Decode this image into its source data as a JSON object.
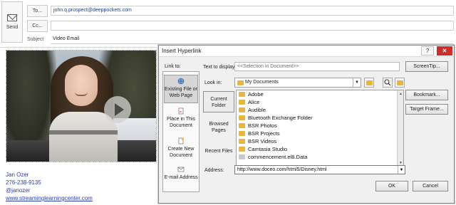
{
  "compose": {
    "send_label": "Send",
    "to_label": "To...",
    "cc_label": "Cc...",
    "subject_label": "Subject",
    "to_value": "john.q.prospect@deeppockets.com",
    "cc_value": "",
    "subject_value": "Video Email"
  },
  "signature": {
    "name": "Jan Ozer",
    "phone": "276-238-9135",
    "handle": "@janozer",
    "website": "www.streaminglearningcenter.com"
  },
  "dialog": {
    "title": "Insert Hyperlink",
    "help_label": "?",
    "close_label": "✕",
    "link_to_label": "Link to:",
    "link_to_items": [
      {
        "label": "Existing File or Web Page",
        "icon": "globe-file-icon"
      },
      {
        "label": "Place in This Document",
        "icon": "document-place-icon"
      },
      {
        "label": "Create New Document",
        "icon": "new-document-icon"
      },
      {
        "label": "E-mail Address",
        "icon": "email-icon"
      }
    ],
    "text_to_display_label": "Text to display:",
    "text_to_display_value": "<<Selection in Document>>",
    "screentip_label": "ScreenTip...",
    "look_in_label": "Look in:",
    "look_in_value": "My Documents",
    "side_items": [
      {
        "label": "Current Folder"
      },
      {
        "label": "Browsed Pages"
      },
      {
        "label": "Recent Files"
      }
    ],
    "files": [
      "Adobe",
      "Alice",
      "Audible",
      "Bluetooth Exchange Folder",
      "BSR Photos",
      "BSR Projects",
      "BSR Videos",
      "Camtasia Studio",
      "commencement.el8.Data"
    ],
    "bookmark_label": "Bookmark...",
    "target_frame_label": "Target Frame...",
    "address_label": "Address:",
    "address_value": "http://www.doceo.com/html5/Disney.html",
    "ok_label": "OK",
    "cancel_label": "Cancel"
  }
}
